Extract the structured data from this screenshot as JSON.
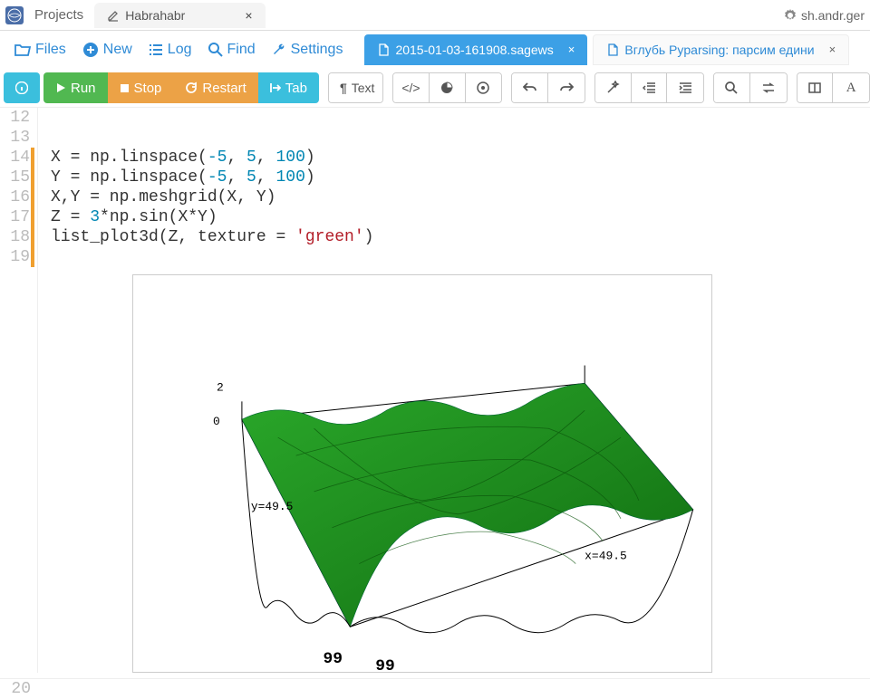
{
  "header": {
    "projects_label": "Projects",
    "tab_label": "Habrahabr",
    "user_label": "sh.andr.ger"
  },
  "menu": {
    "files": "Files",
    "new": "New",
    "log": "Log",
    "find": "Find",
    "settings": "Settings"
  },
  "file_tabs": {
    "active": "2015-01-03-161908.sagews",
    "inactive": "Вглубь Pyparsing: парсим едини"
  },
  "toolbar": {
    "run": "Run",
    "stop": "Stop",
    "restart": "Restart",
    "tab": "Tab",
    "text": "Text"
  },
  "code": {
    "lines": [
      {
        "n": "12",
        "text": ""
      },
      {
        "n": "13",
        "text": ""
      },
      {
        "n": "14",
        "text": "X = np.linspace(-5, 5, 100)"
      },
      {
        "n": "15",
        "text": "Y = np.linspace(-5, 5, 100)"
      },
      {
        "n": "16",
        "text": "X,Y = np.meshgrid(X, Y)"
      },
      {
        "n": "17",
        "text": "Z = 3*np.sin(X*Y)"
      },
      {
        "n": "18",
        "text": "list_plot3d(Z, texture = 'green')"
      },
      {
        "n": "19",
        "text": ""
      }
    ],
    "bottom_line": "20"
  },
  "plot": {
    "axis_y_label": "y=49.5",
    "axis_x_label": "x=49.5",
    "z_top": "2",
    "z_origin": "0",
    "axis_end_1": "99",
    "axis_end_2": "99"
  }
}
